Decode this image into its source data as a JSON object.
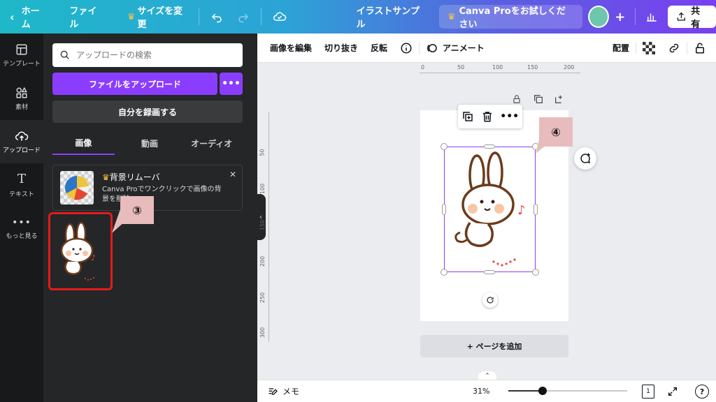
{
  "topbar": {
    "home": "ホーム",
    "file": "ファイル",
    "resize": "サイズを変更",
    "title": "イラストサンプル",
    "pro_cta": "Canva Proをお試しください",
    "share": "共有"
  },
  "rail": {
    "items": [
      {
        "label": "テンプレート",
        "icon": "template-icon"
      },
      {
        "label": "素材",
        "icon": "elements-icon"
      },
      {
        "label": "アップロード",
        "icon": "upload-cloud-icon"
      },
      {
        "label": "テキスト",
        "icon": "text-icon"
      },
      {
        "label": "もっと見る",
        "icon": "more-icon"
      }
    ]
  },
  "panel": {
    "search_placeholder": "アップロードの検索",
    "upload_label": "ファイルをアップロード",
    "more_label": "•••",
    "record_label": "自分を録画する",
    "tabs": [
      "画像",
      "動画",
      "オーディオ"
    ],
    "promo": {
      "title": "背景リムーバ",
      "desc": "Canva Proでワンクリックで画像の背景を削除"
    }
  },
  "callouts": {
    "three": "③",
    "four": "④"
  },
  "toolbar2": {
    "edit_image": "画像を編集",
    "crop": "切り抜き",
    "flip": "反転",
    "animate": "アニメート",
    "position": "配置"
  },
  "rulers": {
    "h": [
      "0",
      "50",
      "100",
      "150",
      "200"
    ],
    "v": [
      "50",
      "100",
      "150",
      "200",
      "250",
      "300"
    ]
  },
  "canvas": {
    "add_page": "+ ページを追加"
  },
  "bottombar": {
    "notes": "メモ",
    "zoom": "31%",
    "page_num": "1"
  },
  "colors": {
    "accent": "#8b3dff",
    "highlight": "#e31b1b",
    "callout_bg": "#e8bcbc"
  }
}
